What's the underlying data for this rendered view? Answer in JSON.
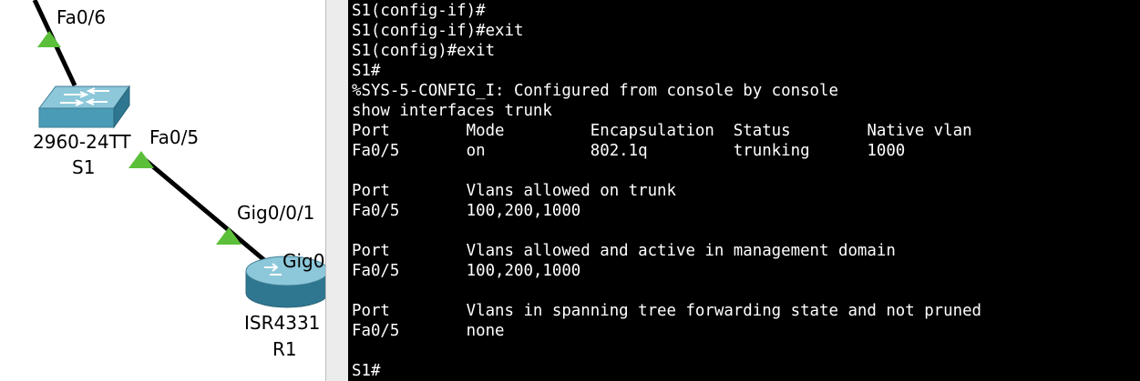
{
  "topology": {
    "switch": {
      "model": "2960-24TT",
      "name": "S1",
      "icon": "switch-icon",
      "color": "#4a9bb5"
    },
    "router": {
      "model": "ISR4331",
      "name": "R1",
      "icon": "router-icon",
      "color": "#4a9bb5"
    },
    "link_color": "#000000",
    "status_color": "#5cbf3a",
    "ports": {
      "switch_upper": "Fa0/6",
      "switch_lower": "Fa0/5",
      "link_end": "Gig0/0/1",
      "router_port": "Gig0"
    }
  },
  "terminal": {
    "background": "#000000",
    "foreground": "#ffffff",
    "lines": [
      "S1(config-if)#",
      "S1(config-if)#exit",
      "S1(config)#exit",
      "S1#",
      "%SYS-5-CONFIG_I: Configured from console by console",
      "show interfaces trunk",
      "Port        Mode         Encapsulation  Status        Native vlan",
      "Fa0/5       on           802.1q         trunking      1000",
      "",
      "Port        Vlans allowed on trunk",
      "Fa0/5       100,200,1000",
      "",
      "Port        Vlans allowed and active in management domain",
      "Fa0/5       100,200,1000",
      "",
      "Port        Vlans in spanning tree forwarding state and not pruned",
      "Fa0/5       none",
      "",
      "S1#"
    ]
  }
}
